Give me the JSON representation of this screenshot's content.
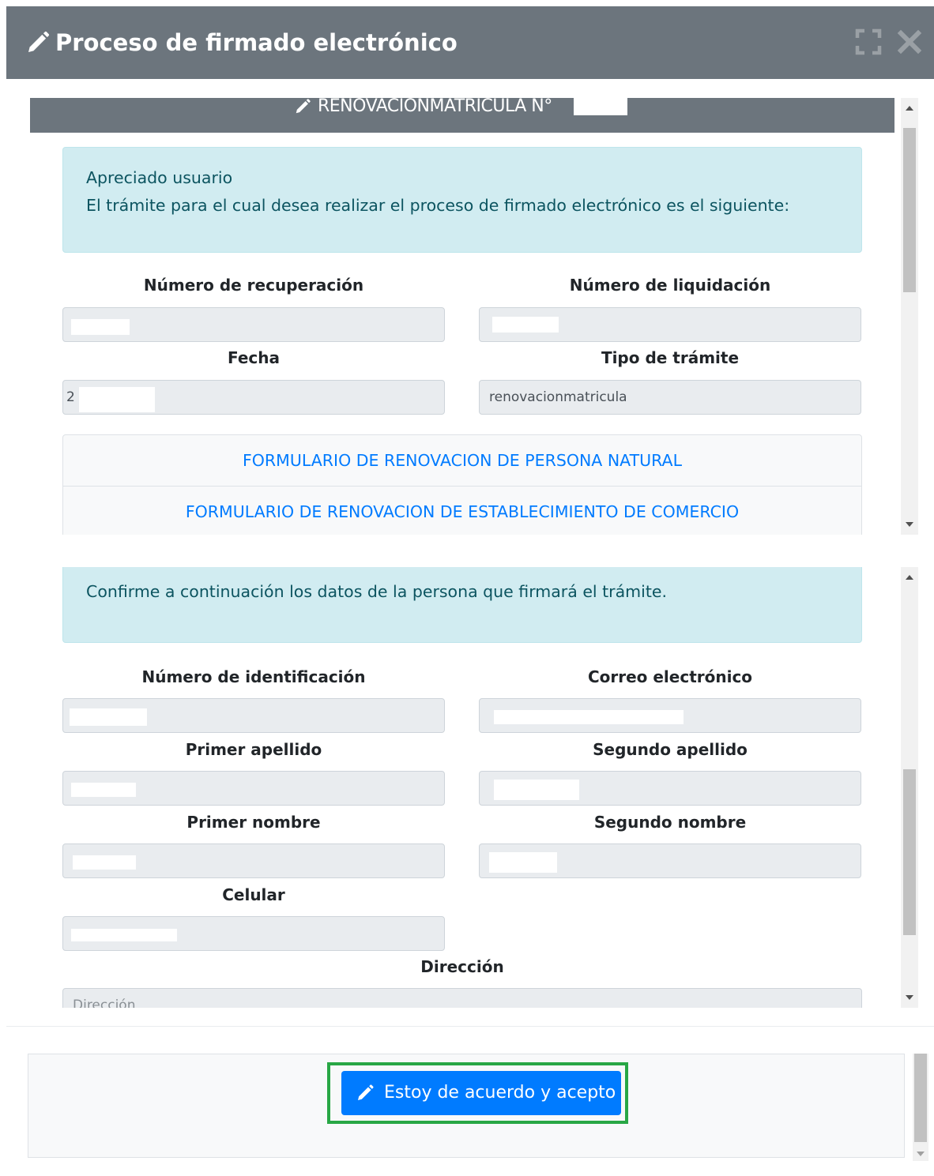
{
  "dialog": {
    "title": "Proceso de firmado electrónico",
    "title_icon": "pencil-icon",
    "controls": [
      "maximize-icon",
      "close-icon"
    ]
  },
  "panel1": {
    "header": "RENOVACIONMATRICULA N°",
    "header_icon": "pencil-icon",
    "alert": {
      "line1": "Apreciado usuario",
      "line2": "El trámite para el cual desea realizar el proceso de firmado electrónico es el siguiente:"
    },
    "fields": {
      "recuperacion": {
        "label": "Número de recuperación",
        "value": ""
      },
      "liquidacion": {
        "label": "Número de liquidación",
        "value": ""
      },
      "fecha": {
        "label": "Fecha",
        "value": "2"
      },
      "tipo": {
        "label": "Tipo de trámite",
        "value": "renovacionmatricula"
      }
    },
    "links": [
      "FORMULARIO DE RENOVACION DE PERSONA NATURAL",
      "FORMULARIO DE RENOVACION DE ESTABLECIMIENTO DE COMERCIO"
    ]
  },
  "panel2": {
    "alert": "Confirme a continuación los datos de la persona que firmará el trámite.",
    "fields": {
      "identificacion": {
        "label": "Número de identificación",
        "value": ""
      },
      "correo": {
        "label": "Correo electrónico",
        "value": ""
      },
      "primer_apellido": {
        "label": "Primer apellido",
        "value": ""
      },
      "segundo_apellido": {
        "label": "Segundo apellido",
        "value": ""
      },
      "primer_nombre": {
        "label": "Primer nombre",
        "value": ""
      },
      "segundo_nombre": {
        "label": "Segundo nombre",
        "value": ""
      },
      "celular": {
        "label": "Celular",
        "value": ""
      },
      "direccion": {
        "label": "Dirección",
        "placeholder": "Dirección"
      }
    }
  },
  "footer": {
    "accept_label": "Estoy de acuerdo y acepto",
    "accept_icon": "pencil-icon",
    "highlight_color": "#28a745"
  },
  "colors": {
    "header_bg": "#6c757d",
    "alert_bg": "#d1ecf1",
    "link": "#007bff",
    "button": "#007bff"
  }
}
